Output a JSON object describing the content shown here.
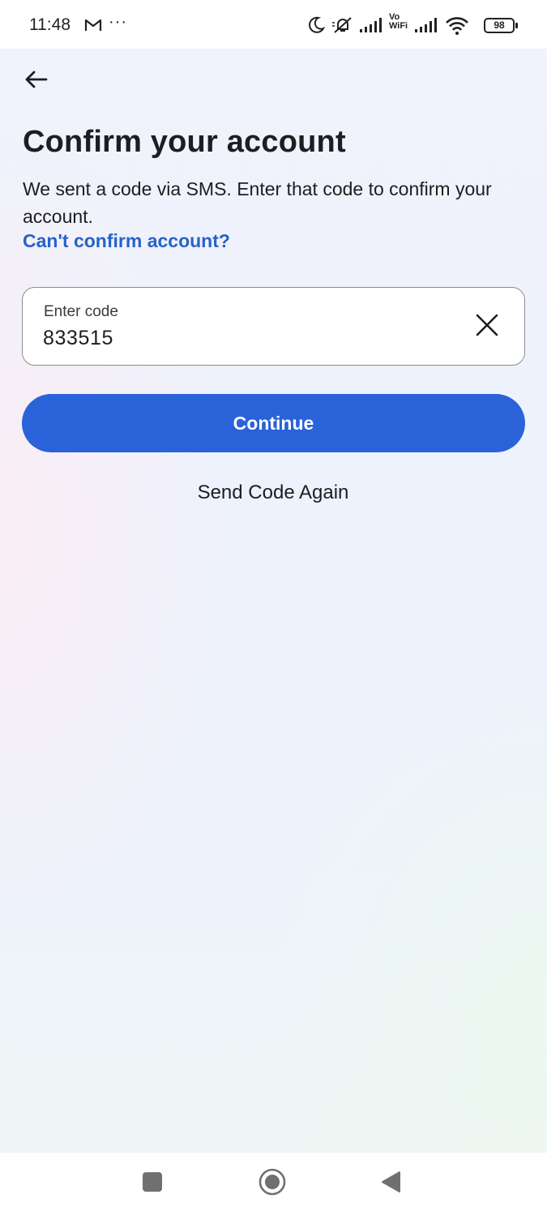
{
  "status_bar": {
    "time": "11:48",
    "overflow": "···",
    "vowifi_top": "Vo",
    "vowifi_bottom": "WiFi",
    "battery": "98",
    "icons": [
      "gmail-icon",
      "moon-icon",
      "mute-icon",
      "signal-icon",
      "wifi-icon",
      "battery-icon"
    ]
  },
  "header": {
    "back_icon": "arrow-left-icon"
  },
  "main": {
    "title": "Confirm your account",
    "description": "We sent a code via SMS. Enter that code to confirm your account.",
    "help_link": "Can't confirm account?",
    "code_field": {
      "label": "Enter code",
      "value": "833515",
      "clear_icon": "close-icon"
    },
    "continue_label": "Continue",
    "send_again_label": "Send Code Again"
  },
  "nav_bar": {
    "icons": [
      "recents-square-icon",
      "home-circle-icon",
      "back-triangle-icon"
    ]
  },
  "colors": {
    "accent": "#2a62d9",
    "link": "#2762c9",
    "text": "#1c1e21"
  }
}
